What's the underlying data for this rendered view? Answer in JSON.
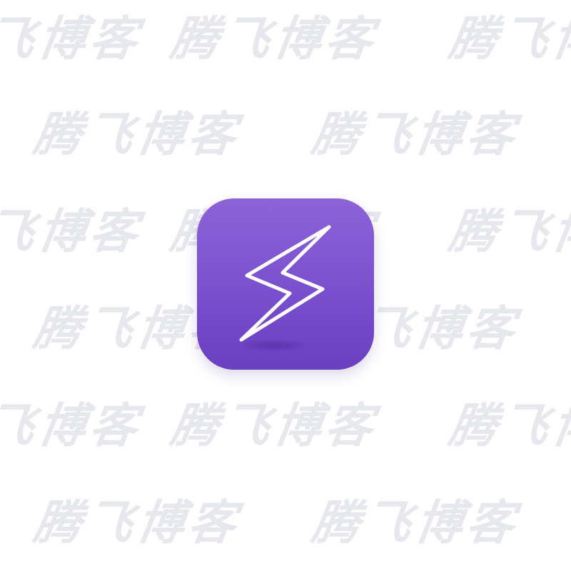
{
  "watermark": {
    "text": "腾飞博客",
    "color": "#e6e8ee"
  },
  "app_icon": {
    "symbol": "lightning-bolt-icon",
    "tile_color": "#7a4fce",
    "outline_color": "#ffffff"
  },
  "colors": {
    "background": "#ffffff"
  }
}
